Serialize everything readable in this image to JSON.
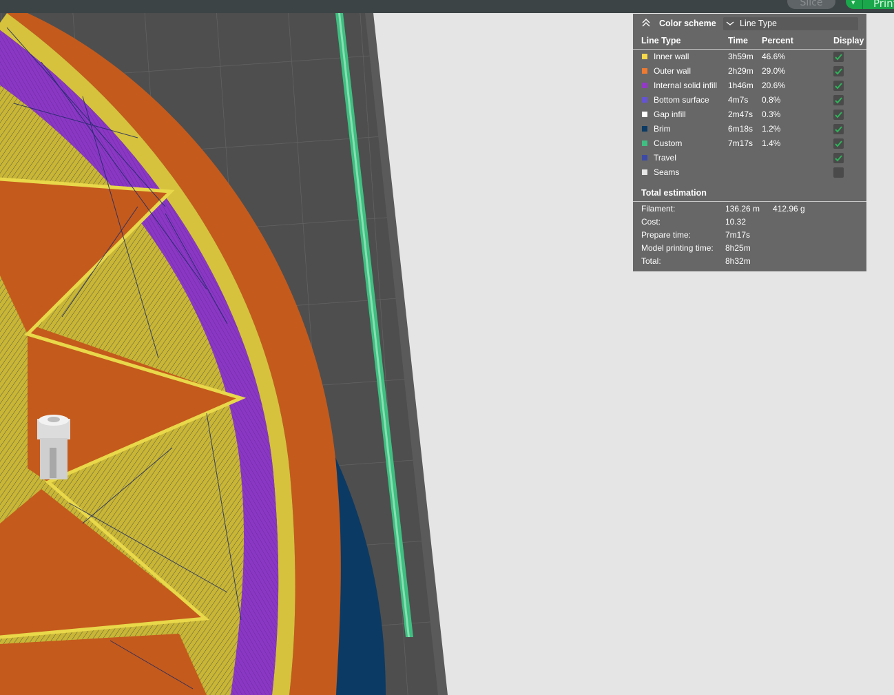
{
  "toolbar": {
    "slice_label": "Slice",
    "print_label": "Print"
  },
  "legend": {
    "title": "Color scheme",
    "scheme_value": "Line Type",
    "columns": [
      "Line Type",
      "Time",
      "Percent",
      "Display"
    ],
    "rows": [
      {
        "name": "Inner wall",
        "time": "3h59m",
        "percent": "46.6%",
        "color": "#f5d94a",
        "display": true
      },
      {
        "name": "Outer wall",
        "time": "2h29m",
        "percent": "29.0%",
        "color": "#ee7b30",
        "display": true
      },
      {
        "name": "Internal solid infill",
        "time": "1h46m",
        "percent": "20.6%",
        "color": "#9438c8",
        "display": true
      },
      {
        "name": "Bottom surface",
        "time": "4m7s",
        "percent": "0.8%",
        "color": "#6453d4",
        "display": true
      },
      {
        "name": "Gap infill",
        "time": "2m47s",
        "percent": "0.3%",
        "color": "#ffffff",
        "display": true
      },
      {
        "name": "Brim",
        "time": "6m18s",
        "percent": "1.2%",
        "color": "#0b3a64",
        "display": true
      },
      {
        "name": "Custom",
        "time": "7m17s",
        "percent": "1.4%",
        "color": "#3fbf81",
        "display": true
      },
      {
        "name": "Travel",
        "time": "",
        "percent": "",
        "color": "#3c4aa6",
        "display": true
      },
      {
        "name": "Seams",
        "time": "",
        "percent": "",
        "color": "#e6e6e6",
        "display": false
      }
    ],
    "total": {
      "title": "Total estimation",
      "filament_label": "Filament:",
      "filament_length": "136.26 m",
      "filament_weight": "412.96 g",
      "cost_label": "Cost:",
      "cost": "10.32",
      "prepare_label": "Prepare time:",
      "prepare": "7m17s",
      "model_label": "Model printing time:",
      "model": "8h25m",
      "total_label": "Total:",
      "total": "8h32m"
    }
  },
  "colors": {
    "plate": "#4e4e4e",
    "grid": "#636363",
    "inner_wall": "#c9b634",
    "outer_wall": "#c45a1c",
    "infill": "#7f32b8",
    "brim": "#0b3a64",
    "custom": "#3fbf81",
    "travel": "#1d2a66",
    "check": "#2fb35a"
  },
  "icons": [
    "collapse-up-icon",
    "chevron-down-icon",
    "checkbox-icon",
    "dropdown-arrow-icon"
  ]
}
